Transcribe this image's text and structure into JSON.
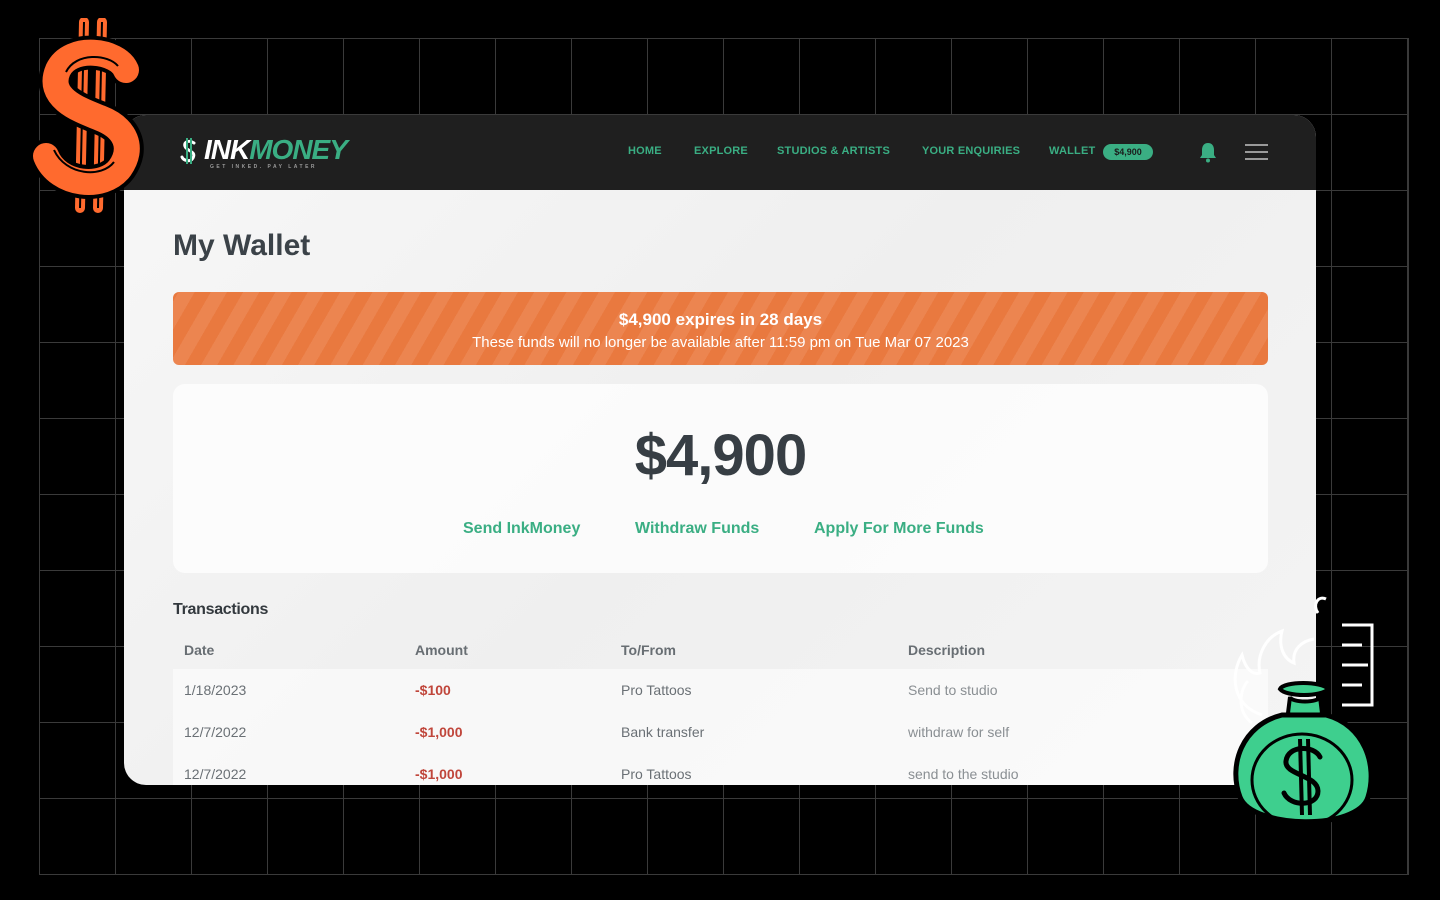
{
  "brand": {
    "name_part1": "INK",
    "name_part2": "MONEY",
    "tagline": "GET INKED. PAY LATER"
  },
  "nav": {
    "items": [
      "HOME",
      "EXPLORE",
      "STUDIOS & ARTISTS",
      "YOUR ENQUIRIES",
      "WALLET"
    ],
    "wallet_badge": "$4,900",
    "icons": [
      "bell-icon",
      "hamburger-menu-icon"
    ]
  },
  "page": {
    "title": "My Wallet"
  },
  "banner": {
    "title": "$4,900 expires in 28 days",
    "subtitle": "These funds will no longer be available after 11:59 pm on Tue Mar 07 2023"
  },
  "balance": {
    "amount": "$4,900",
    "actions": [
      "Send InkMoney",
      "Withdraw Funds",
      "Apply For More Funds"
    ]
  },
  "transactions": {
    "title": "Transactions",
    "columns": [
      "Date",
      "Amount",
      "To/From",
      "Description"
    ],
    "rows": [
      {
        "date": "1/18/2023",
        "amount": "-$100",
        "party": "Pro Tattoos",
        "description": "Send to studio"
      },
      {
        "date": "12/7/2022",
        "amount": "-$1,000",
        "party": "Bank transfer",
        "description": "withdraw for self"
      },
      {
        "date": "12/7/2022",
        "amount": "-$1,000",
        "party": "Pro Tattoos",
        "description": "send to the studio"
      }
    ]
  },
  "colors": {
    "accent": "#3aae83",
    "banner": "#e9793f",
    "negative": "#c0463b",
    "navbar": "#1f1f1f"
  }
}
